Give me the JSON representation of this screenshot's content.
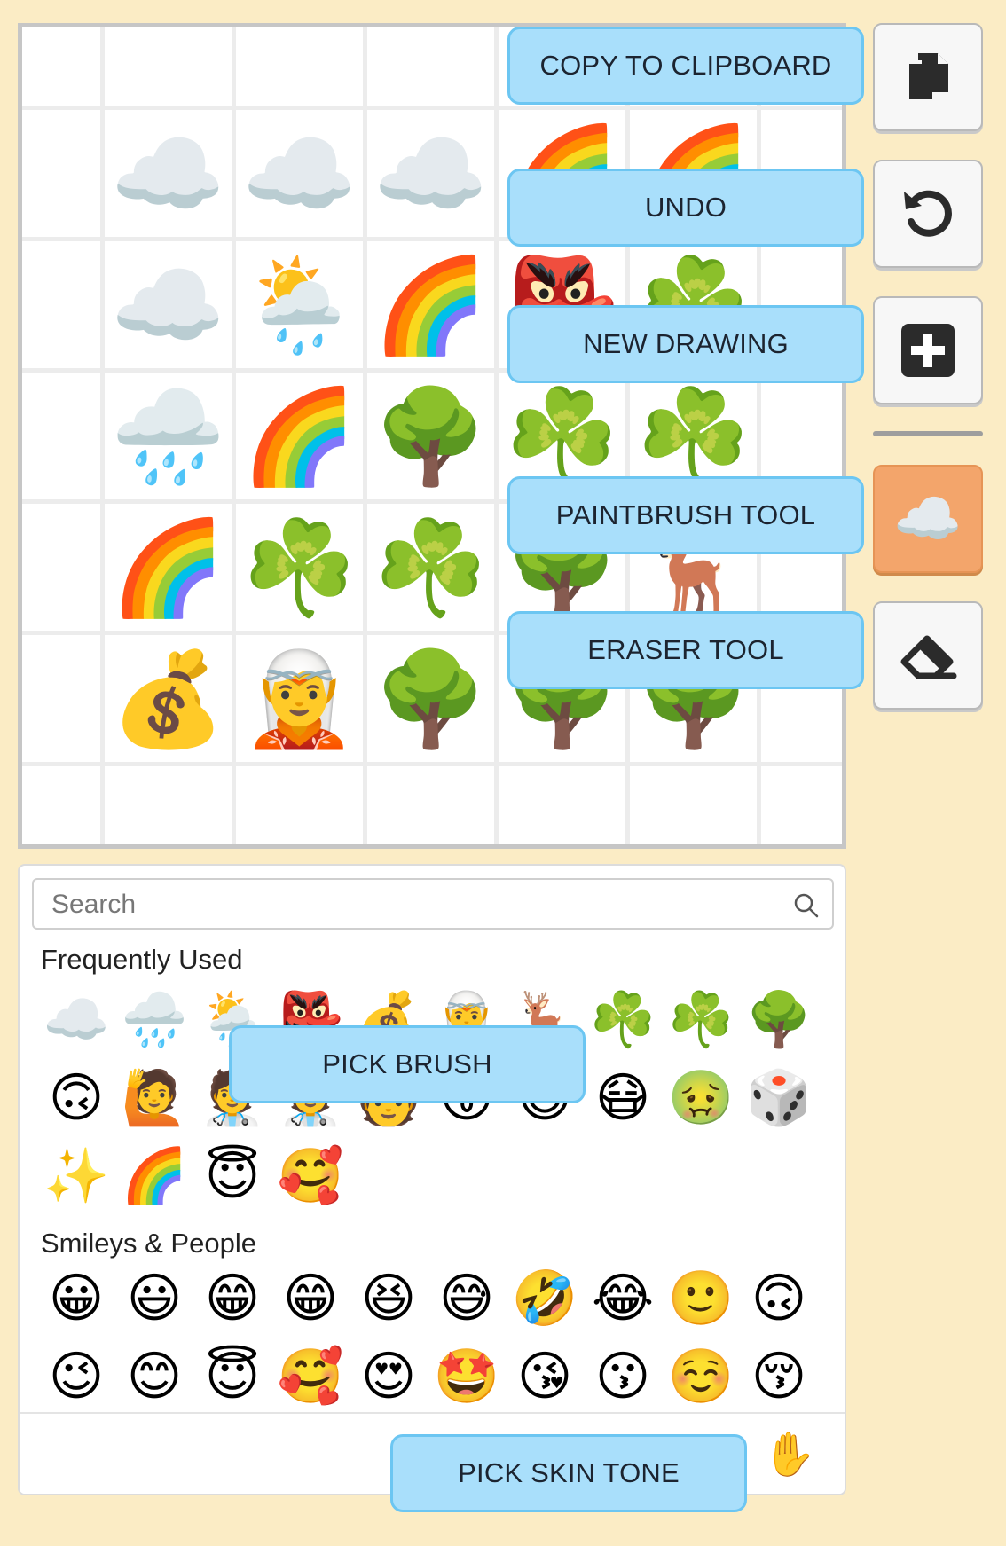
{
  "canvas": {
    "rows": [
      [
        "",
        "",
        "",
        "",
        "",
        "",
        ""
      ],
      [
        "",
        "☁️",
        "☁️",
        "☁️",
        "🌈",
        "🌈",
        ""
      ],
      [
        "",
        "☁️",
        "🌦️",
        "🌈",
        "👺",
        "☘️",
        ""
      ],
      [
        "",
        "🌧️",
        "🌈",
        "🌳",
        "☘️",
        "☘️",
        ""
      ],
      [
        "",
        "🌈",
        "☘️",
        "☘️",
        "🌳",
        "🦌",
        ""
      ],
      [
        "",
        "💰",
        "🧝",
        "🌳",
        "🌳",
        "🌳",
        ""
      ],
      [
        "",
        "",
        "",
        "",
        "",
        "",
        ""
      ]
    ]
  },
  "callouts": {
    "copy": "COPY TO CLIPBOARD",
    "undo": "UNDO",
    "new_drawing": "NEW DRAWING",
    "paintbrush": "PAINTBRUSH TOOL",
    "eraser": "ERASER TOOL",
    "pick_brush": "PICK BRUSH",
    "pick_skin_tone": "PICK SKIN TONE"
  },
  "toolbar": {
    "copy_icon": "copy-icon",
    "undo_icon": "undo-icon",
    "new_icon": "plus-square-icon",
    "current_brush": "☁️",
    "eraser_icon": "eraser-icon",
    "active_color": "#f3a56b"
  },
  "picker": {
    "search_placeholder": "Search",
    "frequently_used_title": "Frequently Used",
    "frequently_used_rows": [
      [
        "☁️",
        "🌧️",
        "🌦️",
        "👺",
        "💰",
        "🧝",
        "🦌",
        "☘️",
        "☘️",
        "🌳"
      ],
      [
        "🙃",
        "🙋",
        "🧑‍⚕️",
        "🧑‍⚕️",
        "🧑",
        "😛",
        "😄",
        "😷",
        "🤢",
        "🎲"
      ],
      [
        "✨",
        "🌈",
        "😇",
        "🥰"
      ]
    ],
    "smileys_title": "Smileys & People",
    "smileys_rows": [
      [
        "😀",
        "😃",
        "😁",
        "😁",
        "😆",
        "😅",
        "🤣",
        "😂",
        "🙂",
        "🙃"
      ],
      [
        "😉",
        "😊",
        "😇",
        "🥰",
        "😍",
        "🤩",
        "😘",
        "😗",
        "☺️",
        "😚"
      ]
    ],
    "skin_tone_emoji": "✋"
  },
  "colors": {
    "background": "#fbecc5",
    "callout_fill": "#a9dffb",
    "callout_border": "#6cc6f2"
  }
}
